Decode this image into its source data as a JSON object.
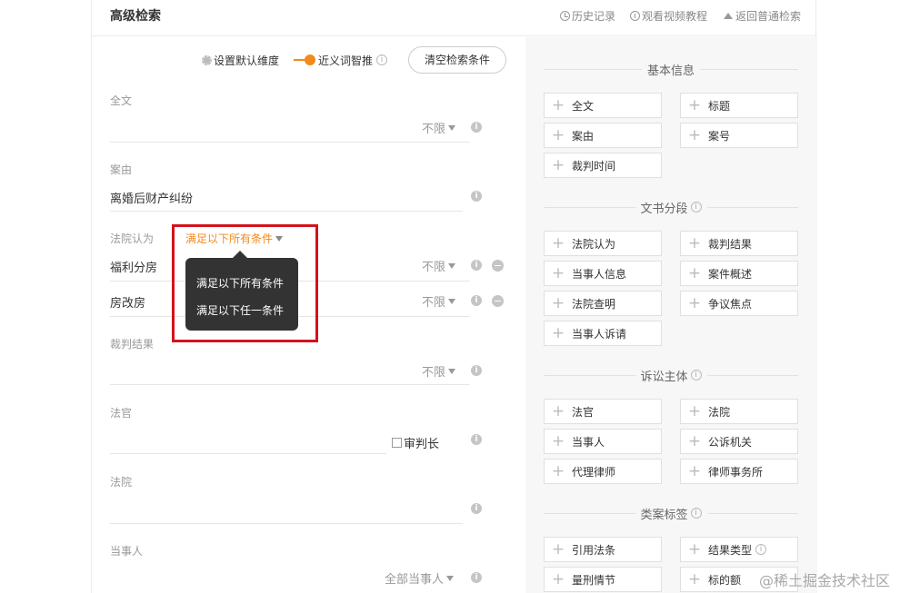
{
  "header": {
    "title": "高级检索",
    "history": "历史记录",
    "tutorial": "观看视频教程",
    "back": "返回普通检索"
  },
  "options": {
    "default_dim": "设置默认维度",
    "synonym": "近义词智推",
    "clear": "清空检索条件"
  },
  "fields": {
    "fulltext": {
      "label": "全文",
      "dropdown": "不限"
    },
    "cause": {
      "label": "案由",
      "value": "离婚后财产纠纷"
    },
    "court_opinion": {
      "label": "法院认为",
      "condition": "满足以下所有条件",
      "rows": [
        {
          "value": "福利分房",
          "dropdown": "不限"
        },
        {
          "value": "房改房",
          "dropdown": "不限"
        }
      ]
    },
    "judgment": {
      "label": "裁判结果",
      "dropdown": "不限"
    },
    "judge": {
      "label": "法官",
      "checkbox": "审判长"
    },
    "court": {
      "label": "法院"
    },
    "party": {
      "label": "当事人",
      "dropdown": "全部当事人"
    }
  },
  "tooltip": {
    "options": [
      "满足以下所有条件",
      "满足以下任一条件"
    ]
  },
  "sidebar": {
    "basic": {
      "title": "基本信息",
      "tags": [
        "全文",
        "标题",
        "案由",
        "案号",
        "裁判时间"
      ]
    },
    "segments": {
      "title": "文书分段",
      "tags": [
        "法院认为",
        "裁判结果",
        "当事人信息",
        "案件概述",
        "法院查明",
        "争议焦点",
        "当事人诉请"
      ]
    },
    "subjects": {
      "title": "诉讼主体",
      "tags": [
        "法官",
        "法院",
        "当事人",
        "公诉机关",
        "代理律师",
        "律师事务所"
      ]
    },
    "labels": {
      "title": "类案标签",
      "tags": [
        "引用法条",
        "结果类型",
        "量刑情节",
        "标的额"
      ]
    }
  },
  "watermark": "@稀土掘金技术社区",
  "colors": {
    "accent": "#f28a1c",
    "highlight_box": "#d3131b"
  }
}
